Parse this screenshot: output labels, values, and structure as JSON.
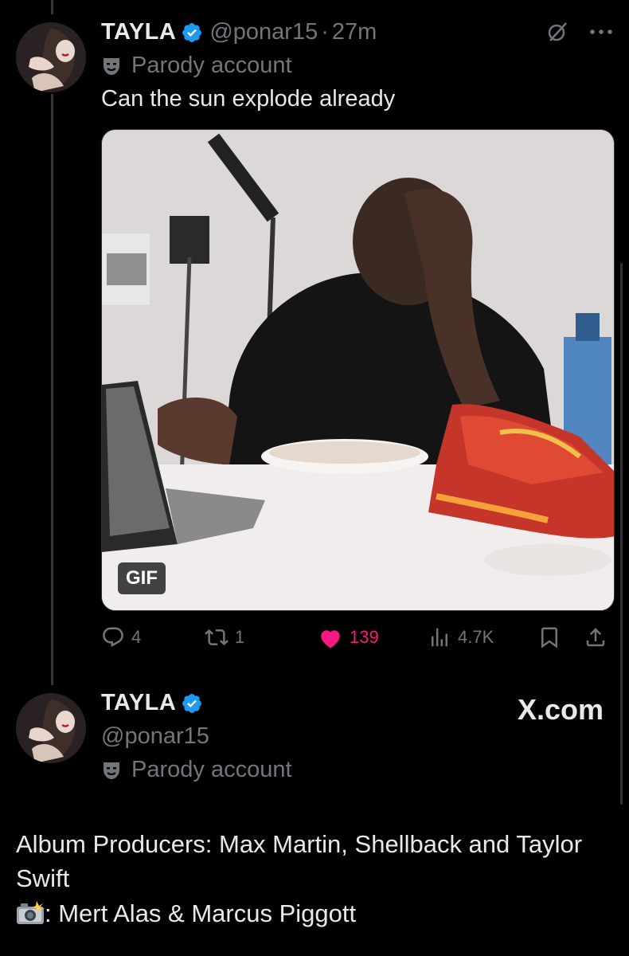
{
  "tweet": {
    "name": "TAYLA",
    "handle": "@ponar15",
    "separator": "·",
    "time": "27m",
    "parody_label": "Parody account",
    "text": "Can the sun explode already",
    "media_badge": "GIF",
    "replies": "4",
    "reposts": "1",
    "likes": "139",
    "views": "4.7K",
    "liked": true
  },
  "profile_card": {
    "name": "TAYLA",
    "handle": "@ponar15",
    "parody_label": "Parody account",
    "brand": "X.com"
  },
  "bio": {
    "line1": "Album Producers: Max Martin, Shellback and Taylor Swift",
    "line2": ": Mert Alas & Marcus Piggott"
  },
  "icons": {
    "verified": "verified-badge-icon",
    "parody": "theater-mask-icon",
    "grok": "grok-icon",
    "more": "more-icon",
    "reply": "reply-icon",
    "repost": "repost-icon",
    "like": "heart-icon",
    "views": "views-icon",
    "bookmark": "bookmark-icon",
    "share": "share-icon",
    "photo": "camera-flash-icon"
  },
  "colors": {
    "background": "#000000",
    "text": "#e7e9ea",
    "muted": "#71767b",
    "verified": "#1d9bf0",
    "like": "#f91880"
  }
}
